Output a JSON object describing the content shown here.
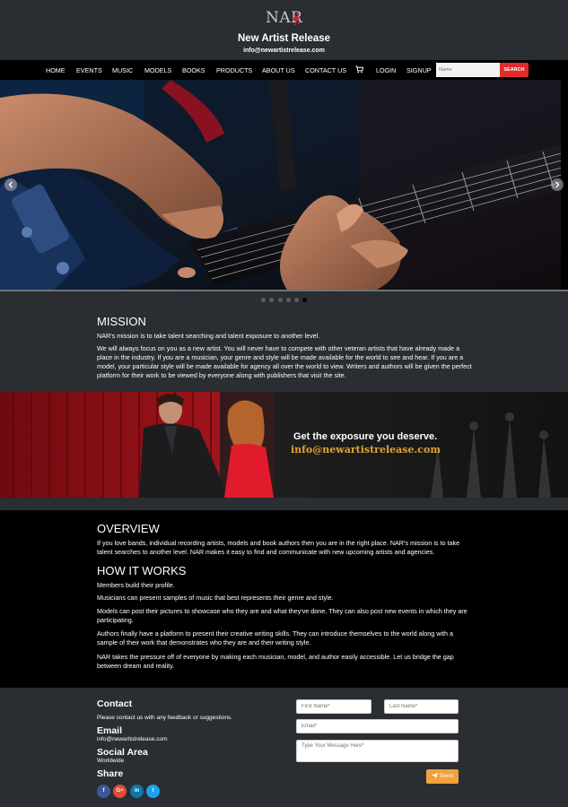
{
  "header": {
    "logo_text": "NAR",
    "title": "New Artist Release",
    "email": "info@newartistrelease.com"
  },
  "nav": {
    "items": [
      {
        "label": "HOME"
      },
      {
        "label": "EVENTS"
      },
      {
        "label": "MUSIC"
      },
      {
        "label": "MODELS"
      },
      {
        "label": "BOOKS"
      },
      {
        "label": "PRODUCTS"
      },
      {
        "label": "ABOUT US"
      },
      {
        "label": "CONTACT US"
      },
      {
        "label": "LOGIN"
      },
      {
        "label": "SIGNUP"
      }
    ],
    "cart_icon": "cart-icon",
    "search": {
      "placeholder": "Name",
      "button_label": "SEARCH"
    }
  },
  "carousel": {
    "slide_count": 6,
    "active_index": 5
  },
  "mission": {
    "heading": "MISSION",
    "lead": "NAR's mission is to take talent searching and talent exposure to another level.",
    "body": "We will always focus on you as a new artist. You will never have to compete with other veteran artists that have already made a place in the industry. If you are a musician, your genre and style will be made available for the world to see and hear. If you are a model, your particular style will be made available for agency all over the world to view. Writers and authors will be given the perfect platform for their work to be viewed by everyone along with publishers that visit the site."
  },
  "banner": {
    "headline": "Get the exposure you deserve.",
    "email": "info@newartistrelease.com"
  },
  "overview": {
    "heading": "OVERVIEW",
    "body": "If you love bands, individual recording artists, models and book authors then you are in the right place. NAR's mission is to take talent searches to another level. NAR makes it easy to find and communicate with new upcoming artists and agencies."
  },
  "how_it_works": {
    "heading": "HOW IT WORKS",
    "paragraphs": [
      "Members build their profile.",
      "Musicians can present samples of music that best represents their genre and style.",
      "Models can post their pictures to showcase who they are and what they've done. They can also post new events in which they are participating.",
      "Authors finally have a platform to present their creative writing skills. They can introduce themselves to the world along with a sample of their work that demonstrates who they are and their writing style.",
      "NAR takes the pressure off of everyone by making each musician, model, and author easily accessible. Let us bridge the gap between dream and reality."
    ]
  },
  "footer": {
    "contact_heading": "Contact",
    "contact_text": "Please contact us with any feedback or suggestions.",
    "email_heading": "Email",
    "email_value": "info@newartistrelease.com",
    "social_heading": "Social Area",
    "social_value": "Worldwide",
    "share_heading": "Share",
    "share_icons": [
      {
        "icon": "facebook-icon",
        "glyph": "f",
        "color": "#3b5998"
      },
      {
        "icon": "google-plus-icon",
        "glyph": "G+",
        "color": "#dd4b39"
      },
      {
        "icon": "linkedin-icon",
        "glyph": "in",
        "color": "#0e76a8"
      },
      {
        "icon": "twitter-icon",
        "glyph": "t",
        "color": "#1da1f2"
      }
    ],
    "form": {
      "first_name_placeholder": "First Name*",
      "last_name_placeholder": "Last Name*",
      "email_placeholder": "Email*",
      "message_placeholder": "Type Your Message Here*",
      "send_label": "Send"
    }
  }
}
